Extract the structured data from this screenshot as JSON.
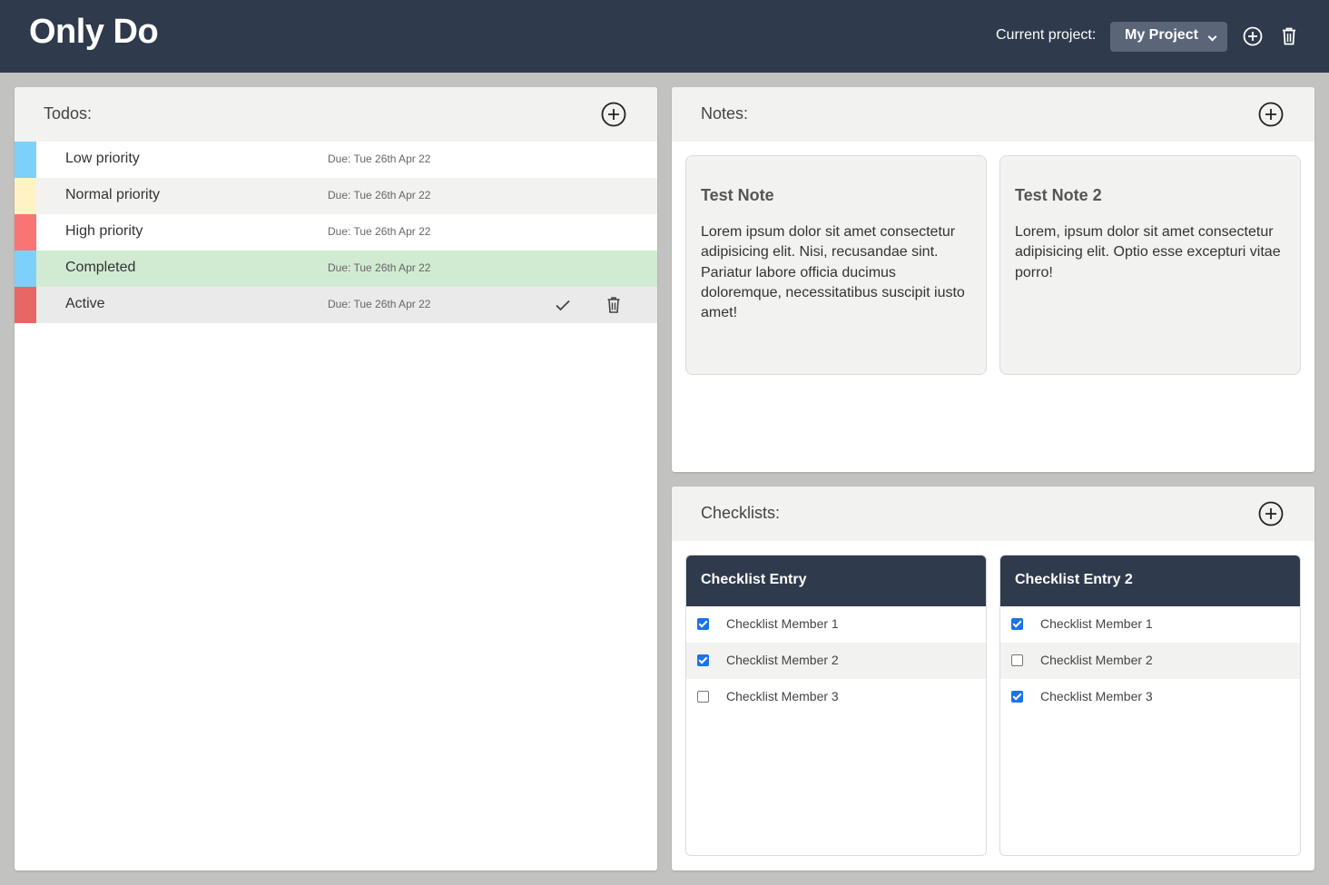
{
  "header": {
    "app_title": "Only Do",
    "project_label": "Current project:",
    "project_selected": "My Project",
    "bg_color": "#2f3a4c"
  },
  "todos": {
    "title": "Todos:",
    "items": [
      {
        "title": "Low priority",
        "due": "Due: Tue 26th Apr 22",
        "priority_color": "#7dd0fa",
        "state": "normal"
      },
      {
        "title": "Normal priority",
        "due": "Due: Tue 26th Apr 22",
        "priority_color": "#fff3c6",
        "state": "normal"
      },
      {
        "title": "High priority",
        "due": "Due: Tue 26th Apr 22",
        "priority_color": "#f97474",
        "state": "normal"
      },
      {
        "title": "Completed",
        "due": "Due: Tue 26th Apr 22",
        "priority_color": "#7dd0fa",
        "state": "completed"
      },
      {
        "title": "Active",
        "due": "Due: Tue 26th Apr 22",
        "priority_color": "#e76767",
        "state": "active"
      }
    ],
    "row_colors": {
      "normal_odd": "#ffffff",
      "normal_even": "#f2f2f1",
      "completed": "#d1ebd3",
      "active": "#eaeaea"
    }
  },
  "notes": {
    "title": "Notes:",
    "items": [
      {
        "title": "Test Note",
        "body": "Lorem ipsum dolor sit amet consectetur adipisicing elit. Nisi, recusandae sint. Pariatur labore officia ducimus doloremque, necessitatibus suscipit iusto amet!"
      },
      {
        "title": "Test Note 2",
        "body": "Lorem, ipsum dolor sit amet consectetur adipisicing elit. Optio esse excepturi vitae porro!"
      }
    ]
  },
  "checklists": {
    "title": "Checklists:",
    "lists": [
      {
        "title": "Checklist Entry",
        "members": [
          {
            "label": "Checklist Member 1",
            "checked": true
          },
          {
            "label": "Checklist Member 2",
            "checked": true
          },
          {
            "label": "Checklist Member 3",
            "checked": false
          }
        ]
      },
      {
        "title": "Checklist Entry 2",
        "members": [
          {
            "label": "Checklist Member 1",
            "checked": true
          },
          {
            "label": "Checklist Member 2",
            "checked": false
          },
          {
            "label": "Checklist Member 3",
            "checked": true
          }
        ]
      }
    ],
    "accent_color": "#1a73e8"
  }
}
